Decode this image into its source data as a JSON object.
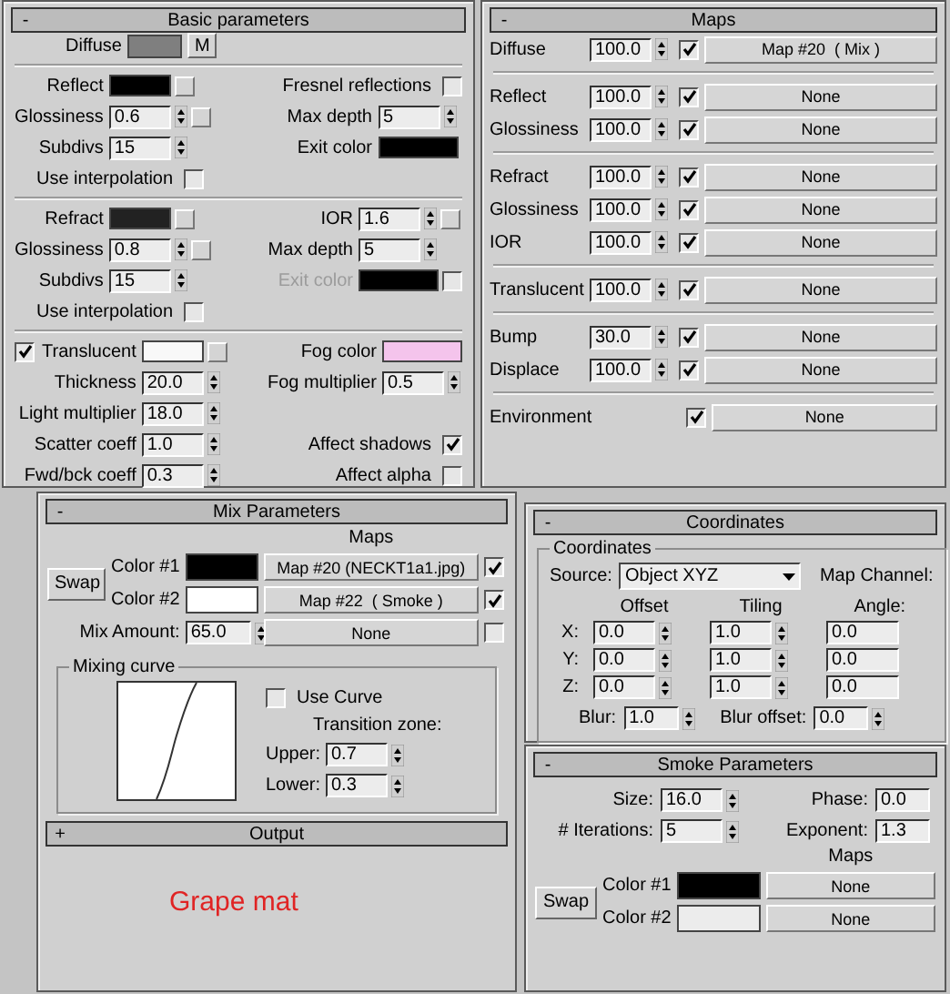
{
  "basic_parameters": {
    "title": "Basic parameters",
    "collapse": "-",
    "diffuse": {
      "label": "Diffuse",
      "color": "#7f7f7f",
      "button": "M"
    },
    "sections": [
      {
        "rows": [
          {
            "left": {
              "kind": "color",
              "label": "Reflect",
              "color": "#000000",
              "slot": true
            },
            "right": {
              "kind": "checkbox",
              "label": "Fresnel reflections",
              "checked": false
            }
          },
          {
            "left": {
              "kind": "spinner",
              "label": "Glossiness",
              "value": "0.6",
              "slot": true
            },
            "right": {
              "kind": "spinner",
              "label": "Max depth",
              "value": "5"
            }
          },
          {
            "left": {
              "kind": "spinner",
              "label": "Subdivs",
              "value": "15"
            },
            "right": {
              "kind": "color",
              "label": "Exit color",
              "color": "#000000"
            }
          },
          {
            "left": {
              "kind": "checkbox",
              "label": "Use interpolation",
              "checked": false
            }
          }
        ]
      },
      {
        "rows": [
          {
            "left": {
              "kind": "color",
              "label": "Refract",
              "color": "#222222",
              "slot": true
            },
            "right": {
              "kind": "spinner",
              "label": "IOR",
              "value": "1.6",
              "slot": true
            }
          },
          {
            "left": {
              "kind": "spinner",
              "label": "Glossiness",
              "value": "0.8",
              "slot": true
            },
            "right": {
              "kind": "spinner",
              "label": "Max depth",
              "value": "5"
            }
          },
          {
            "left": {
              "kind": "spinner",
              "label": "Subdivs",
              "value": "15"
            },
            "right": {
              "kind": "colorcheck",
              "label": "Exit color",
              "color": "#000000",
              "disabled": true,
              "checked": false
            }
          },
          {
            "left": {
              "kind": "checkbox",
              "label": "Use interpolation",
              "checked": false
            }
          }
        ]
      },
      {
        "rows": [
          {
            "left": {
              "kind": "checkcolor",
              "label": "Translucent",
              "color": "#f8f8f8",
              "slot": true,
              "checked": true
            },
            "right": {
              "kind": "color",
              "label": "Fog color",
              "color": "#f4c4ec"
            }
          },
          {
            "left": {
              "kind": "spinner",
              "label": "Thickness",
              "value": "20.0"
            },
            "right": {
              "kind": "spinner",
              "label": "Fog multiplier",
              "value": "0.5"
            }
          },
          {
            "left": {
              "kind": "spinner",
              "label": "Light multiplier",
              "value": "18.0"
            }
          },
          {
            "left": {
              "kind": "spinner",
              "label": "Scatter coeff",
              "value": "1.0"
            },
            "right": {
              "kind": "checkbox",
              "label": "Affect shadows",
              "checked": true
            }
          },
          {
            "left": {
              "kind": "spinner",
              "label": "Fwd/bck coeff",
              "value": "0.3"
            },
            "right": {
              "kind": "checkbox",
              "label": "Affect alpha",
              "checked": false
            }
          }
        ]
      }
    ]
  },
  "maps": {
    "title": "Maps",
    "collapse": "-",
    "groups": [
      {
        "rows": [
          {
            "label": "Diffuse",
            "amount": "100.0",
            "checked": true,
            "map": "Map #20  ( Mix )"
          }
        ]
      },
      {
        "rows": [
          {
            "label": "Reflect",
            "amount": "100.0",
            "checked": true,
            "map": "None"
          },
          {
            "label": "Glossiness",
            "amount": "100.0",
            "checked": true,
            "map": "None"
          }
        ]
      },
      {
        "rows": [
          {
            "label": "Refract",
            "amount": "100.0",
            "checked": true,
            "map": "None"
          },
          {
            "label": "Glossiness",
            "amount": "100.0",
            "checked": true,
            "map": "None"
          },
          {
            "label": "IOR",
            "amount": "100.0",
            "checked": true,
            "map": "None"
          }
        ]
      },
      {
        "rows": [
          {
            "label": "Translucent",
            "amount": "100.0",
            "checked": true,
            "map": "None"
          }
        ]
      },
      {
        "rows": [
          {
            "label": "Bump",
            "amount": "30.0",
            "checked": true,
            "map": "None"
          },
          {
            "label": "Displace",
            "amount": "100.0",
            "checked": true,
            "map": "None"
          }
        ]
      },
      {
        "rows": [
          {
            "label": "Environment",
            "checked": true,
            "map": "None"
          }
        ]
      }
    ]
  },
  "mix_parameters": {
    "title": "Mix Parameters",
    "collapse": "-",
    "maps_label": "Maps",
    "swap": "Swap",
    "colors": [
      {
        "label": "Color #1",
        "color": "#000000",
        "map": "Map #20 (NECKT1a1.jpg)",
        "checked": true
      },
      {
        "label": "Color #2",
        "color": "#ffffff",
        "map": "Map #22  ( Smoke )",
        "checked": true
      }
    ],
    "mix_amount": {
      "label": "Mix Amount:",
      "value": "65.0",
      "map": "None",
      "checked": false
    },
    "mixing_curve": {
      "title": "Mixing curve",
      "use_curve": {
        "label": "Use Curve",
        "checked": false
      },
      "transition_zone": "Transition zone:",
      "upper": {
        "label": "Upper:",
        "value": "0.7"
      },
      "lower": {
        "label": "Lower:",
        "value": "0.3"
      }
    },
    "output": {
      "title": "Output",
      "collapse": "+"
    },
    "caption": "Grape mat"
  },
  "coordinates": {
    "title": "Coordinates",
    "collapse": "-",
    "group_title": "Coordinates",
    "source": {
      "label": "Source:",
      "value": "Object XYZ"
    },
    "map_channel": "Map Channel:",
    "columns": [
      "Offset",
      "Tiling",
      "Angle:"
    ],
    "rows": [
      {
        "axis": "X:",
        "values": [
          "0.0",
          "1.0",
          "0.0"
        ]
      },
      {
        "axis": "Y:",
        "values": [
          "0.0",
          "1.0",
          "0.0"
        ]
      },
      {
        "axis": "Z:",
        "values": [
          "0.0",
          "1.0",
          "0.0"
        ]
      }
    ],
    "blur": {
      "label": "Blur:",
      "value": "1.0"
    },
    "blur_offset": {
      "label": "Blur offset:",
      "value": "0.0"
    }
  },
  "smoke_parameters": {
    "title": "Smoke Parameters",
    "collapse": "-",
    "size": {
      "label": "Size:",
      "value": "16.0"
    },
    "phase": {
      "label": "Phase:",
      "value": "0.0"
    },
    "iterations": {
      "label": "# Iterations:",
      "value": "5"
    },
    "exponent": {
      "label": "Exponent:",
      "value": "1.3"
    },
    "maps_label": "Maps",
    "swap": "Swap",
    "colors": [
      {
        "label": "Color #1",
        "color": "#000000",
        "map": "None"
      },
      {
        "label": "Color #2",
        "color": "#ececec",
        "map": "None"
      }
    ]
  }
}
